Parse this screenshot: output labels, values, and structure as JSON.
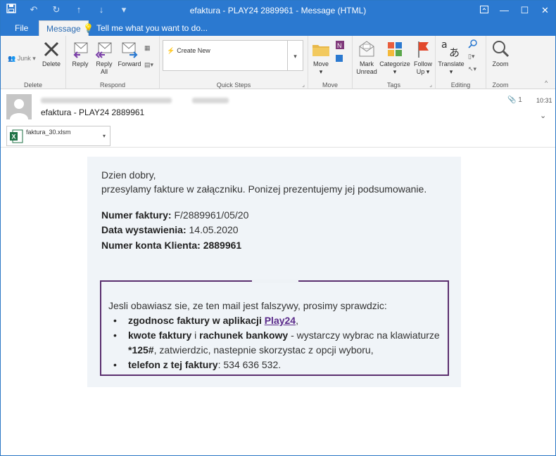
{
  "window": {
    "title": "efaktura - PLAY24 2889961 - Message (HTML)",
    "controls": [
      "restore-down",
      "minimize",
      "maximize",
      "close"
    ]
  },
  "tabs": {
    "file": "File",
    "message": "Message",
    "tellme": "Tell me what you want to do..."
  },
  "ribbon": {
    "delete_group": {
      "junk": "Junk",
      "delete": "Delete",
      "label": "Delete"
    },
    "respond_group": {
      "reply": "Reply",
      "reply_all_1": "Reply",
      "reply_all_2": "All",
      "forward": "Forward",
      "label": "Respond"
    },
    "quicksteps_group": {
      "create_new": "Create New",
      "label": "Quick Steps"
    },
    "move_group": {
      "move": "Move",
      "label": "Move"
    },
    "tags_group": {
      "mark_unread_1": "Mark",
      "mark_unread_2": "Unread",
      "categorize": "Categorize",
      "follow_up_1": "Follow",
      "follow_up_2": "Up",
      "label": "Tags"
    },
    "editing_group": {
      "translate": "Translate",
      "label": "Editing"
    },
    "zoom_group": {
      "zoom": "Zoom",
      "label": "Zoom"
    }
  },
  "header": {
    "subject": "efaktura - PLAY24 2889961",
    "attachment_count": "1",
    "time": "10:31",
    "attachment_name": "faktura_30.xlsm"
  },
  "email": {
    "greeting": "Dzien dobry,",
    "intro": "przesylamy fakture w załączniku. Ponizej prezentujemy jej podsumowanie.",
    "invoice_label": "Numer faktury:",
    "invoice_value": "F/2889961/05/20",
    "date_label": "Data wystawienia:",
    "date_value": "14.05.2020",
    "account_label": "Numer konta Klienta:",
    "account_value": "2889961",
    "notice_intro": "Jesli obawiasz sie, ze ten mail jest falszywy, prosimy sprawdzic:",
    "item1_bold": "zgodnosc faktury w aplikacji",
    "item1_link": "Play24",
    "item1_tail": ",",
    "item2_bold1": "kwote faktury",
    "item2_mid": " i ",
    "item2_bold2": "rachunek bankowy",
    "item2_tail": " - wystarczy wybrac na klawiaturze",
    "item2_code": "*125#",
    "item2_tail2": ", zatwierdzic, nastepnie skorzystac z opcji wyboru,",
    "item3_bold": "telefon z tej faktury",
    "item3_tail": ": 534 636 532."
  }
}
